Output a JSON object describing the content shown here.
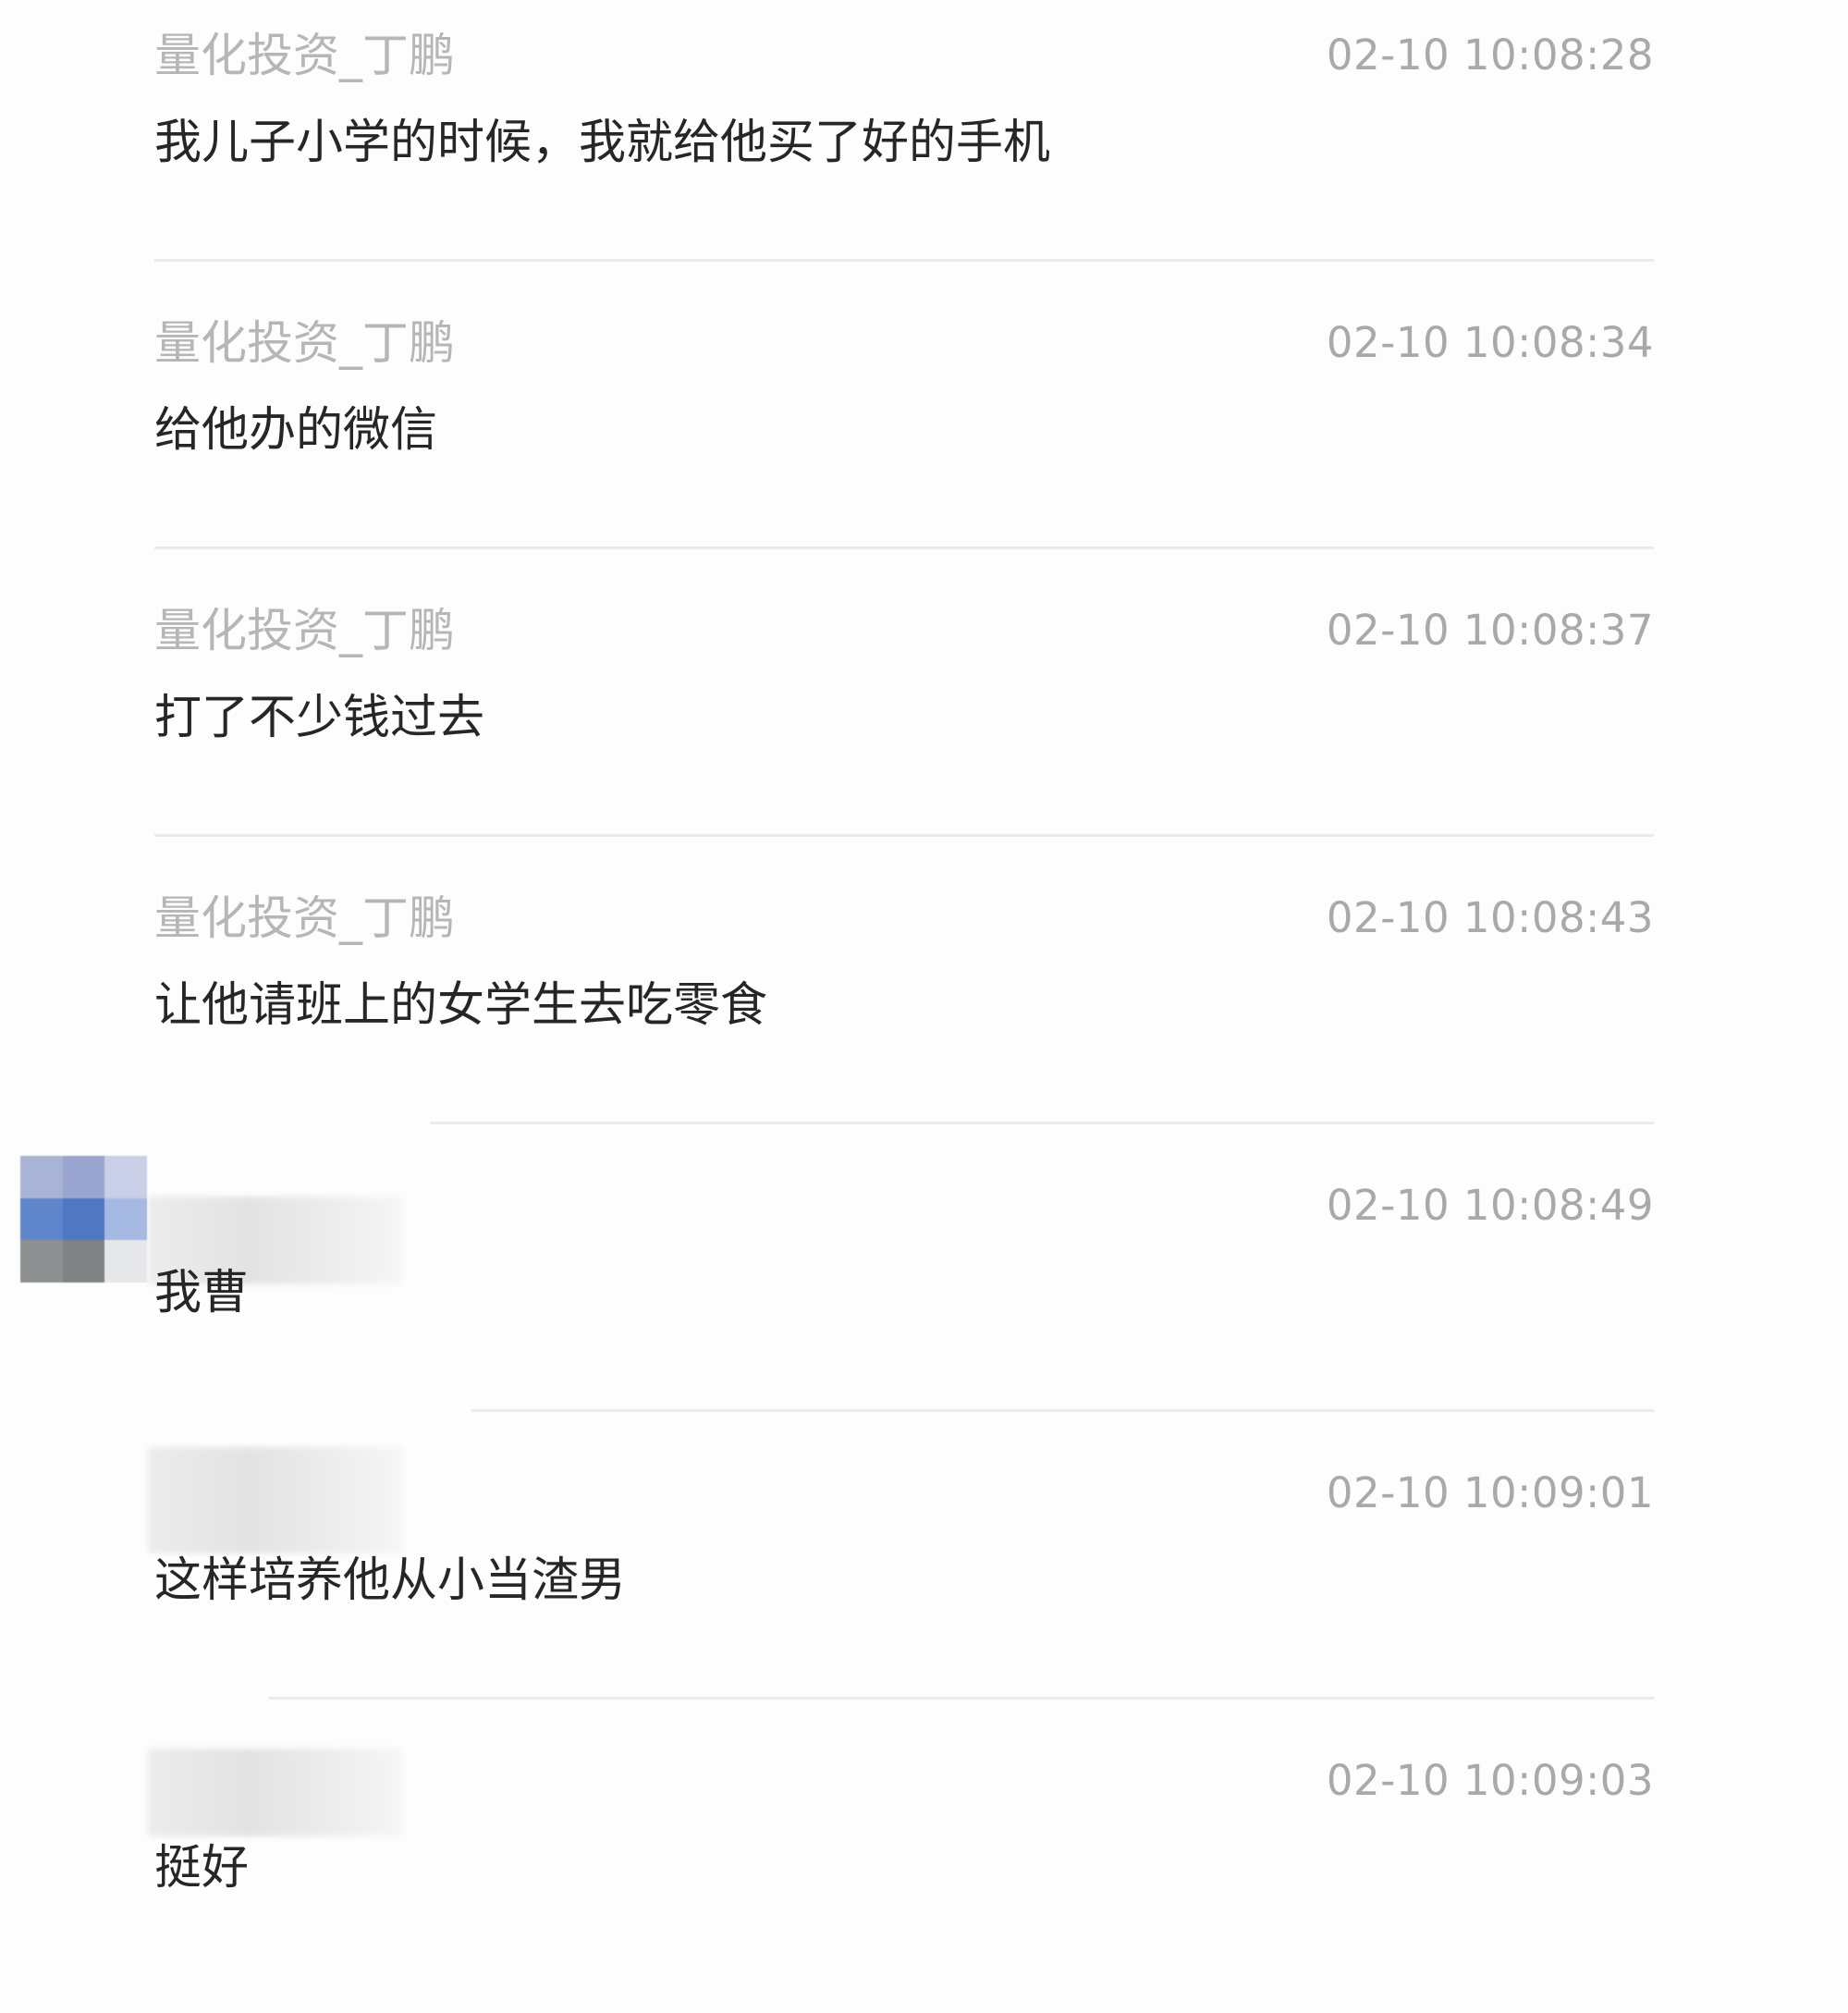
{
  "messages": [
    {
      "sender": "量化投资_丁鹏",
      "time": "02-10 10:08:28",
      "text": "我儿子小学的时候，我就给他买了好的手机",
      "sender_hidden": false
    },
    {
      "sender": "量化投资_丁鹏",
      "time": "02-10 10:08:34",
      "text": "给他办的微信",
      "sender_hidden": false
    },
    {
      "sender": "量化投资_丁鹏",
      "time": "02-10 10:08:37",
      "text": "打了不少钱过去",
      "sender_hidden": false
    },
    {
      "sender": "量化投资_丁鹏",
      "time": "02-10 10:08:43",
      "text": "让他请班上的女学生去吃零食",
      "sender_hidden": false
    },
    {
      "sender": "",
      "time": "02-10 10:08:49",
      "text": "我曹",
      "sender_hidden": true
    },
    {
      "sender": "",
      "time": "02-10 10:09:01",
      "text": "这样培养他从小当渣男",
      "sender_hidden": true
    },
    {
      "sender": "",
      "time": "02-10 10:09:03",
      "text": "挺好",
      "sender_hidden": true
    }
  ],
  "colors": {
    "background": "#fdfdfd",
    "sender": "#b6b6b6",
    "time": "#a9a9a9",
    "text": "#262626",
    "divider": "#ebebeb",
    "avatar_mosaic": [
      "#a9b3d6",
      "#9aa5cf",
      "#c9cfe6",
      "#5f86cb",
      "#4f77c2",
      "#a6b9e3",
      "#8d9090",
      "#7f8383",
      "#e6e7e9"
    ]
  }
}
